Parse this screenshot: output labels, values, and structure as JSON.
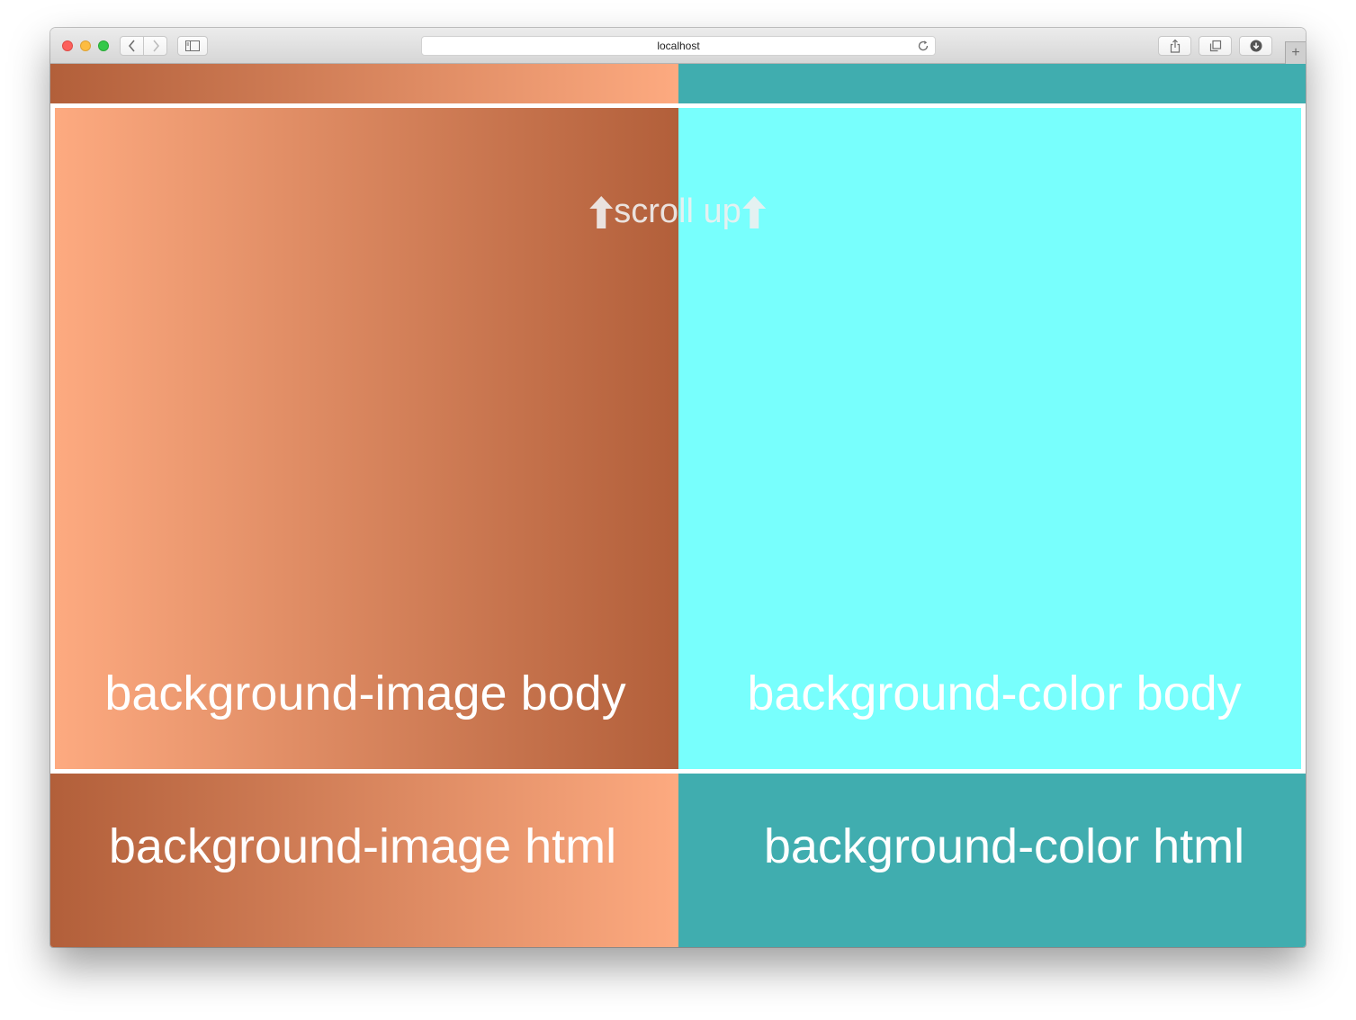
{
  "browser": {
    "address": "localhost",
    "new_tab_symbol": "+",
    "icons": {
      "back": "chevron-left-icon",
      "forward": "chevron-right-icon",
      "sidebar": "sidebar-icon",
      "reload": "reload-icon",
      "share": "share-icon",
      "tabs": "tabs-overview-icon",
      "download": "download-icon"
    }
  },
  "page": {
    "scroll_hint": "scroll up",
    "body_image_label": "background-image body",
    "body_color_label": "background-color body",
    "html_image_label": "background-image html",
    "html_color_label": "background-color html"
  },
  "colors": {
    "gradient_dark": "#b25f3a",
    "gradient_light": "#fdaa80",
    "html_background_color": "#40adaf",
    "body_background_color": "#78fffd",
    "frame_border": "#ffffff",
    "label_text": "#ffffff"
  }
}
